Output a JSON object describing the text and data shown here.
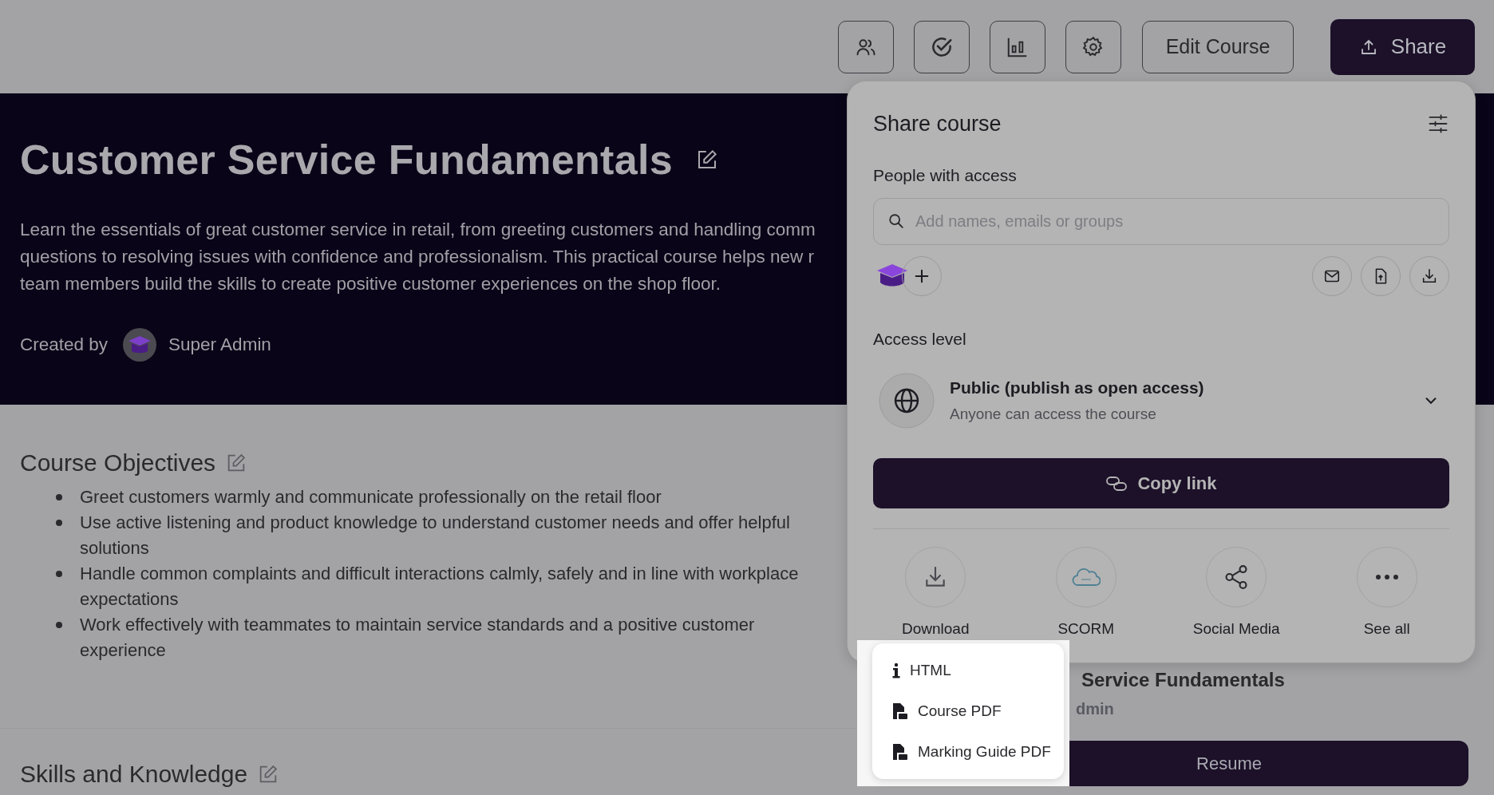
{
  "toolbar": {
    "edit_button": "Edit Course",
    "share_button": "Share"
  },
  "course": {
    "title": "Customer Service Fundamentals",
    "description_lines": [
      "Learn the essentials of great customer service in retail, from greeting customers and handling comm",
      "questions to resolving issues with confidence and professionalism. This practical course helps new r",
      "team members build the skills to create positive customer experiences on the shop floor."
    ],
    "created_by_label": "Created by",
    "author": "Super Admin"
  },
  "objectives": {
    "heading": "Course Objectives",
    "items": [
      "Greet customers warmly and communicate professionally on the retail floor",
      "Use active listening and product knowledge to understand customer needs and offer helpful solutions",
      "Handle common complaints and difficult interactions calmly, safely and in line with workplace expectations",
      "Work effectively with teammates to maintain service standards and a positive customer experience"
    ]
  },
  "skills": {
    "heading": "Skills and Knowledge"
  },
  "side_card": {
    "title": "Service Fundamentals",
    "author": "dmin",
    "button": "Resume"
  },
  "share_panel": {
    "title": "Share course",
    "people_heading": "People with access",
    "search": {
      "placeholder": "Add names, emails or groups"
    },
    "access_heading": "Access level",
    "access": {
      "title": "Public (publish as open access)",
      "subtitle": "Anyone can access the course"
    },
    "copy_button": "Copy link",
    "options": [
      {
        "kind": "download",
        "label": "Download"
      },
      {
        "kind": "scorm",
        "label": "SCORM"
      },
      {
        "kind": "social",
        "label": "Social Media"
      },
      {
        "kind": "more",
        "label": "See all"
      }
    ]
  },
  "download_menu": [
    {
      "kind": "info",
      "label": "HTML"
    },
    {
      "kind": "pdf",
      "label": "Course PDF"
    },
    {
      "kind": "pdf",
      "label": "Marking Guide PDF"
    }
  ]
}
